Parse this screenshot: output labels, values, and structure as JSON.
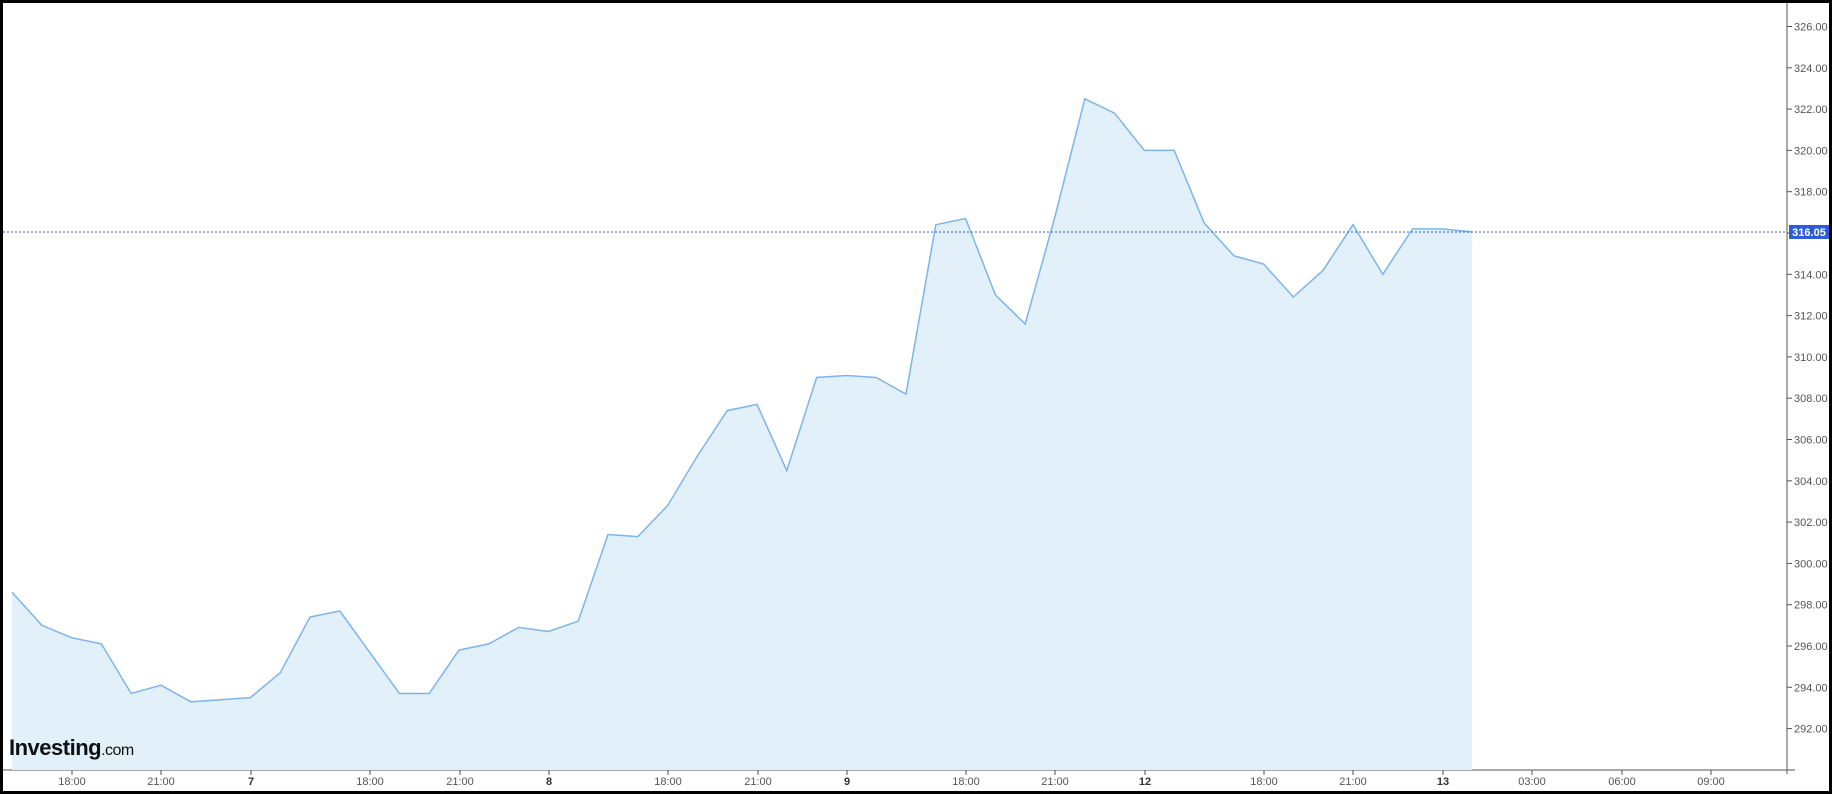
{
  "logo": {
    "main": "Investing",
    "suffix": ".com"
  },
  "colors": {
    "line": "#7cb5ec",
    "area": "#e1f0f9",
    "current_price_line": "#2e5bd6",
    "price_tag_bg": "#2e5bd6",
    "axis": "#555555",
    "frame": "#000000"
  },
  "chart_data": {
    "type": "area",
    "title": "",
    "xlabel": "",
    "ylabel": "",
    "ylim": [
      290,
      327
    ],
    "y_ticks": [
      "292.00",
      "294.00",
      "296.00",
      "298.00",
      "300.00",
      "302.00",
      "304.00",
      "306.00",
      "308.00",
      "310.00",
      "312.00",
      "314.00",
      "316.00",
      "318.00",
      "320.00",
      "322.00",
      "324.00",
      "326.00"
    ],
    "x_ticks": [
      {
        "label": "18:00",
        "bold": false
      },
      {
        "label": "21:00",
        "bold": false
      },
      {
        "label": "7",
        "bold": true
      },
      {
        "label": "18:00",
        "bold": false
      },
      {
        "label": "21:00",
        "bold": false
      },
      {
        "label": "8",
        "bold": true
      },
      {
        "label": "18:00",
        "bold": false
      },
      {
        "label": "21:00",
        "bold": false
      },
      {
        "label": "9",
        "bold": true
      },
      {
        "label": "18:00",
        "bold": false
      },
      {
        "label": "21:00",
        "bold": false
      },
      {
        "label": "12",
        "bold": true
      },
      {
        "label": "18:00",
        "bold": false
      },
      {
        "label": "21:00",
        "bold": false
      },
      {
        "label": "13",
        "bold": true
      },
      {
        "label": "03:00",
        "bold": false
      },
      {
        "label": "06:00",
        "bold": false
      },
      {
        "label": "09:00",
        "bold": false
      }
    ],
    "current_price": 316.05,
    "current_price_label": "316.05",
    "series": [
      {
        "values": [
          298.6,
          297.0,
          296.4,
          296.1,
          293.7,
          294.1,
          293.3,
          293.4,
          293.5,
          294.7,
          297.4,
          297.7,
          295.7,
          293.7,
          293.7,
          295.8,
          296.1,
          296.9,
          296.7,
          297.2,
          301.4,
          301.3,
          302.8,
          305.2,
          307.4,
          307.7,
          304.5,
          309.0,
          309.1,
          309.0,
          308.2,
          316.4,
          316.7,
          313.0,
          311.6,
          316.8,
          322.5,
          321.8,
          320.0,
          320.0,
          316.5,
          314.9,
          314.5,
          312.9,
          314.2,
          316.4,
          314.0,
          316.2,
          316.2,
          316.05
        ]
      }
    ]
  }
}
